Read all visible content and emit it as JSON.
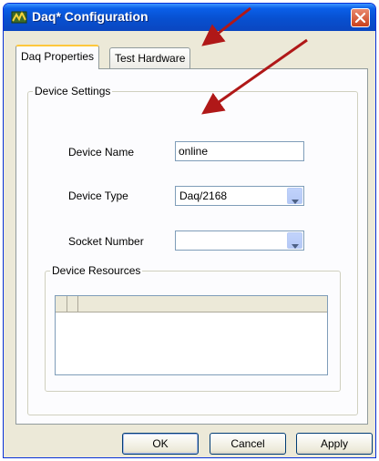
{
  "window": {
    "title": "Daq* Configuration"
  },
  "tabs": [
    {
      "label": "Daq Properties",
      "active": true
    },
    {
      "label": "Test Hardware",
      "active": false
    }
  ],
  "device_settings": {
    "legend": "Device Settings",
    "device_name": {
      "label": "Device Name",
      "value": "online"
    },
    "device_type": {
      "label": "Device Type",
      "value": "Daq/2168"
    },
    "socket_number": {
      "label": "Socket Number",
      "value": ""
    },
    "device_resources": {
      "legend": "Device Resources"
    }
  },
  "buttons": {
    "ok": "OK",
    "cancel": "Cancel",
    "apply": "Apply"
  },
  "colors": {
    "annotation_arrow": "#b01818",
    "title_bar": "#0a5fe8",
    "dialog_face": "#ece9d8"
  },
  "icons": {
    "app": "daq-app-icon",
    "close": "close-icon",
    "dropdown": "chevron-down-icon"
  }
}
